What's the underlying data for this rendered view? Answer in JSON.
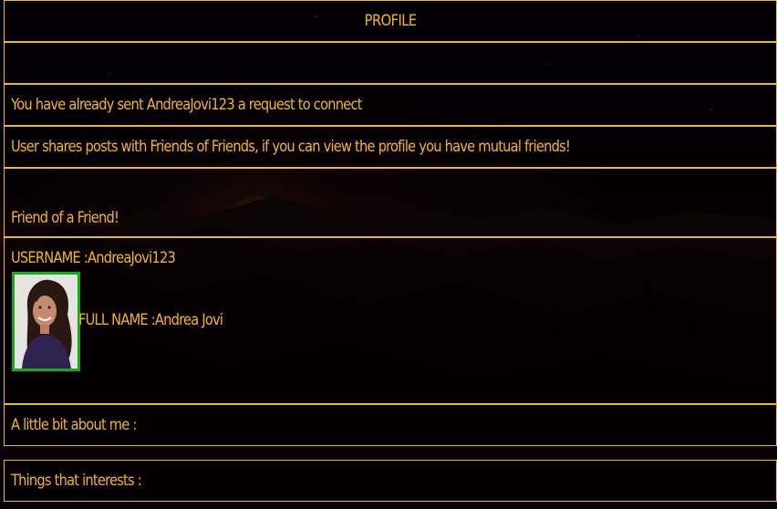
{
  "profile": {
    "header_title": "PROFILE",
    "empty_notice": "",
    "request_status": "You have already sent AndreaJovi123 a request to connect",
    "privacy_notice": "User shares posts with Friends of Friends, if you can view the profile you have mutual friends!",
    "relationship": "Friend of a Friend!",
    "username_label": "USERNAME :",
    "username_value": "AndreaJovi123",
    "fullname_label": "FULL NAME :",
    "fullname_value": "Andrea Jovi",
    "about_label": "A little bit about me :",
    "interests_label": "Things that interests :",
    "avatar_icon": "user-photo-icon"
  },
  "colors": {
    "text_accent": "#f3b52b",
    "border": "#e9b53a",
    "avatar_border": "#19a81b"
  }
}
